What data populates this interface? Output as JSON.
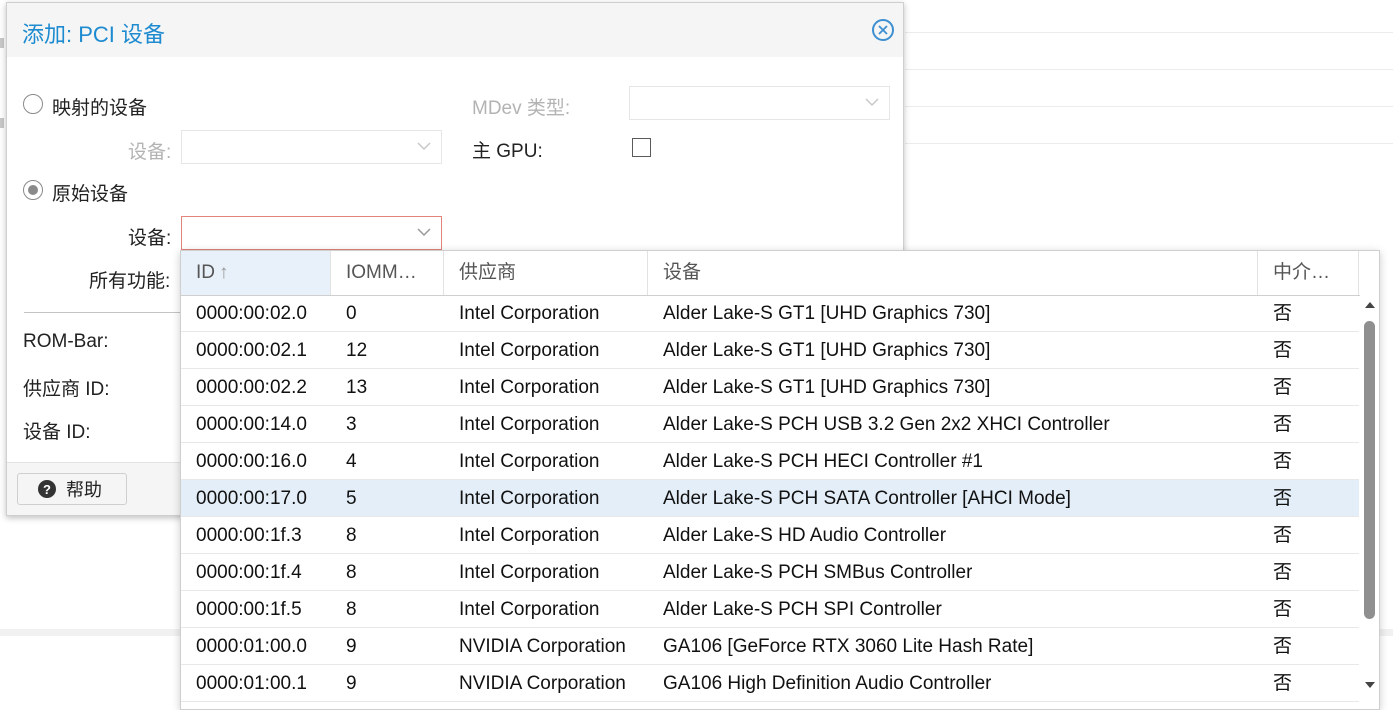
{
  "dialog": {
    "title": "添加: PCI 设备",
    "mapped_device_label": "映射的设备",
    "device_label": "设备:",
    "raw_device_label": "原始设备",
    "raw_device_field_label": "设备:",
    "all_functions_label": "所有功能:",
    "mdev_type_label": "MDev 类型:",
    "primary_gpu_label": "主 GPU:",
    "rombar_label": "ROM-Bar:",
    "vendor_id_label": "供应商 ID:",
    "device_id_label": "设备 ID:",
    "help_label": "帮助",
    "mode_selected": "原始设备",
    "primary_gpu_checked": false
  },
  "grid": {
    "columns": [
      "ID",
      "IOMM…",
      "供应商",
      "设备",
      "中介…"
    ],
    "sort_column": "ID",
    "sort_direction": "ascending",
    "selected_row_id": "0000:00:17.0",
    "rows": [
      {
        "id": "0000:00:02.0",
        "iommu": "0",
        "vendor": "Intel Corporation",
        "device": "Alder Lake-S GT1 [UHD Graphics 730]",
        "mdev": "否"
      },
      {
        "id": "0000:00:02.1",
        "iommu": "12",
        "vendor": "Intel Corporation",
        "device": "Alder Lake-S GT1 [UHD Graphics 730]",
        "mdev": "否"
      },
      {
        "id": "0000:00:02.2",
        "iommu": "13",
        "vendor": "Intel Corporation",
        "device": "Alder Lake-S GT1 [UHD Graphics 730]",
        "mdev": "否"
      },
      {
        "id": "0000:00:14.0",
        "iommu": "3",
        "vendor": "Intel Corporation",
        "device": "Alder Lake-S PCH USB 3.2 Gen 2x2 XHCI Controller",
        "mdev": "否"
      },
      {
        "id": "0000:00:16.0",
        "iommu": "4",
        "vendor": "Intel Corporation",
        "device": "Alder Lake-S PCH HECI Controller #1",
        "mdev": "否"
      },
      {
        "id": "0000:00:17.0",
        "iommu": "5",
        "vendor": "Intel Corporation",
        "device": "Alder Lake-S PCH SATA Controller [AHCI Mode]",
        "mdev": "否"
      },
      {
        "id": "0000:00:1f.3",
        "iommu": "8",
        "vendor": "Intel Corporation",
        "device": "Alder Lake-S HD Audio Controller",
        "mdev": "否"
      },
      {
        "id": "0000:00:1f.4",
        "iommu": "8",
        "vendor": "Intel Corporation",
        "device": "Alder Lake-S PCH SMBus Controller",
        "mdev": "否"
      },
      {
        "id": "0000:00:1f.5",
        "iommu": "8",
        "vendor": "Intel Corporation",
        "device": "Alder Lake-S PCH SPI Controller",
        "mdev": "否"
      },
      {
        "id": "0000:01:00.0",
        "iommu": "9",
        "vendor": "NVIDIA Corporation",
        "device": "GA106 [GeForce RTX 3060 Lite Hash Rate]",
        "mdev": "否"
      },
      {
        "id": "0000:01:00.1",
        "iommu": "9",
        "vendor": "NVIDIA Corporation",
        "device": "GA106 High Definition Audio Controller",
        "mdev": "否"
      }
    ]
  },
  "colors": {
    "title": "#1e8bd0",
    "selected_row": "#e3eef8",
    "invalid_field_border": "#e2847a"
  },
  "icons": {
    "close": "close-circle-icon",
    "help": "question-circle-icon",
    "dropdown": "chevron-down-icon",
    "sort": "arrow-up-icon"
  }
}
